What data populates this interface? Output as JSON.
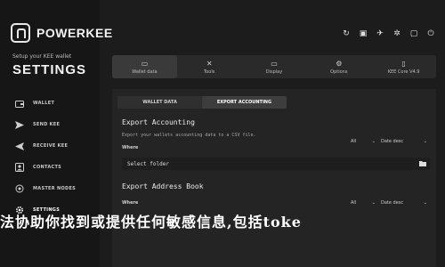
{
  "brand": {
    "name": "POWERKEE"
  },
  "sidebar": {
    "subtitle": "Setup your KEE wallet",
    "title": "SETTINGS",
    "items": [
      {
        "label": "WALLET",
        "icon": "wallet-icon"
      },
      {
        "label": "SEND KEE",
        "icon": "send-icon"
      },
      {
        "label": "RECEIVE KEE",
        "icon": "receive-icon"
      },
      {
        "label": "CONTACTS",
        "icon": "contacts-icon"
      },
      {
        "label": "MASTER NODES",
        "icon": "master-nodes-icon"
      },
      {
        "label": "SETTINGS",
        "icon": "gear-icon"
      }
    ]
  },
  "tabs": [
    {
      "label": "Wallet data"
    },
    {
      "label": "Tools"
    },
    {
      "label": "Display"
    },
    {
      "label": "Options"
    },
    {
      "label": "KEE Core V4.9"
    }
  ],
  "subtabs": [
    {
      "label": "WALLET DATA"
    },
    {
      "label": "EXPORT ACCOUNTING"
    }
  ],
  "export_accounting": {
    "title": "Export Accounting",
    "description": "Export your wallets accounting data to a CSV file.",
    "where_label": "Where",
    "filter1": "All",
    "filter2": "Date desc",
    "folder_placeholder": "Select folder"
  },
  "export_address_book": {
    "title": "Export Address Book",
    "where_label": "Where",
    "filter1": "All",
    "filter2": "Date desc"
  },
  "overlay_text": "法协助你找到或提供任何敏感信息,包括toke",
  "colors": {
    "background": "#1c1c1c",
    "sidebar": "#161616",
    "panel": "#242424"
  }
}
